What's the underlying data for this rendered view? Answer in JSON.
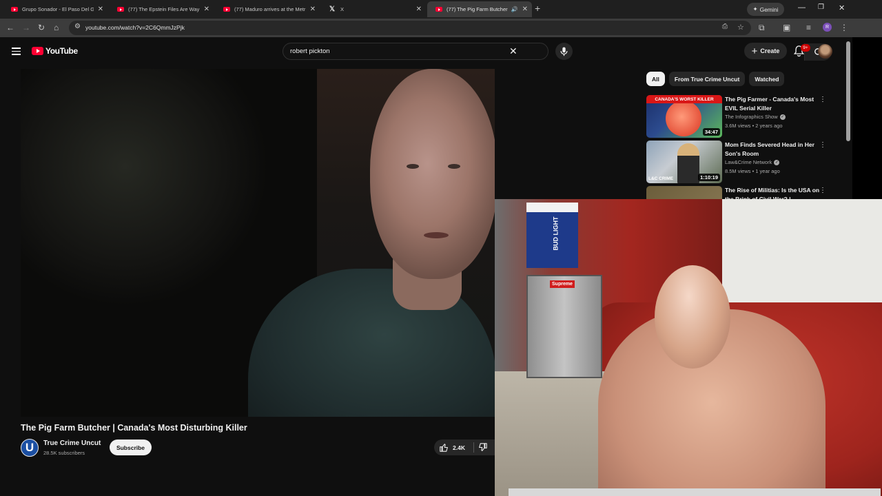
{
  "browser": {
    "tabs": [
      {
        "title": "Grupo Sonador - El Paso Del Gi",
        "favicon": "youtube-icon",
        "active": false
      },
      {
        "title": "(77) The Epstein Files Are Way",
        "favicon": "youtube-icon",
        "active": false
      },
      {
        "title": "(77) Maduro arrives at the Metr",
        "favicon": "youtube-icon",
        "active": false
      },
      {
        "title": "X",
        "favicon": "x-icon",
        "active": false
      },
      {
        "title": "(77) The Pig Farm Butcher |",
        "favicon": "youtube-icon",
        "active": true,
        "audio": true
      }
    ],
    "gemini_label": "Gemini",
    "url": "youtube.com/watch?v=2C6QmmJzPjk",
    "profile_initial": "R"
  },
  "youtube": {
    "logo_text": "YouTube",
    "search": {
      "query": "robert pickton"
    },
    "create_label": "Create",
    "notification_count": "9+"
  },
  "video": {
    "title": "The Pig Farm Butcher | Canada's Most Disturbing Killer",
    "channel": {
      "name": "True Crime Uncut",
      "initial": "U",
      "subscribers": "28.5K subscribers"
    },
    "subscribe_label": "Subscribe",
    "likes": "2.4K"
  },
  "sidebar": {
    "chips": [
      "All",
      "From True Crime Uncut",
      "Watched"
    ],
    "recommendations": [
      {
        "title": "The Pig Farmer - Canada's Most EVIL Serial Killer",
        "channel": "The Infographics Show",
        "meta": "3.6M views • 2 years ago",
        "duration": "34:47",
        "thumb_text": "CANADA'S WORST KILLER"
      },
      {
        "title": "Mom Finds Severed Head in Her Son's Room",
        "channel": "Law&Crime Network",
        "meta": "8.5M views • 1 year ago",
        "duration": "1:10:19",
        "thumb_text": "L&C CRIME"
      },
      {
        "title": "The Rise of Militias: Is the USA on the Brink of Civil War? |",
        "channel": "",
        "meta": "",
        "duration": "",
        "thumb_text": ""
      }
    ]
  },
  "webcam": {
    "box_text": "BUD LIGHT",
    "sticker_text": "Supreme"
  },
  "colors": {
    "youtube_red": "#ff0033",
    "background": "#0f0f0f",
    "chip_bg": "#272727"
  }
}
